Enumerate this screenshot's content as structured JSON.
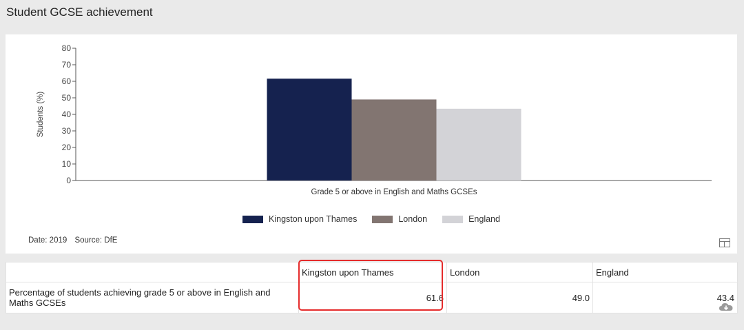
{
  "page_title": "Student GCSE achievement",
  "chart_data": {
    "type": "bar",
    "categories": [
      "Grade 5 or above in English and Maths GCSEs"
    ],
    "series": [
      {
        "name": "Kingston upon Thames",
        "values": [
          61.6
        ],
        "color": "#15224f"
      },
      {
        "name": "London",
        "values": [
          49.0
        ],
        "color": "#827571"
      },
      {
        "name": "England",
        "values": [
          43.4
        ],
        "color": "#d3d3d7"
      }
    ],
    "ylabel": "Students (%)",
    "ylim": [
      0,
      80
    ],
    "yticks": [
      0,
      10,
      20,
      30,
      40,
      50,
      60,
      70,
      80
    ],
    "legend": "bottom",
    "grid": false
  },
  "source": {
    "date": "Date: 2019",
    "source": "Source: DfE"
  },
  "icons": {
    "table": "table-icon",
    "download": "cloud-download-icon"
  },
  "table": {
    "headers": [
      "",
      "Kingston upon Thames",
      "London",
      "England"
    ],
    "row_label": "Percentage of students achieving grade 5 or above in English and Maths GCSEs",
    "row_values": [
      "61.6",
      "49.0",
      "43.4"
    ]
  },
  "highlight_color": "#e52b2b"
}
